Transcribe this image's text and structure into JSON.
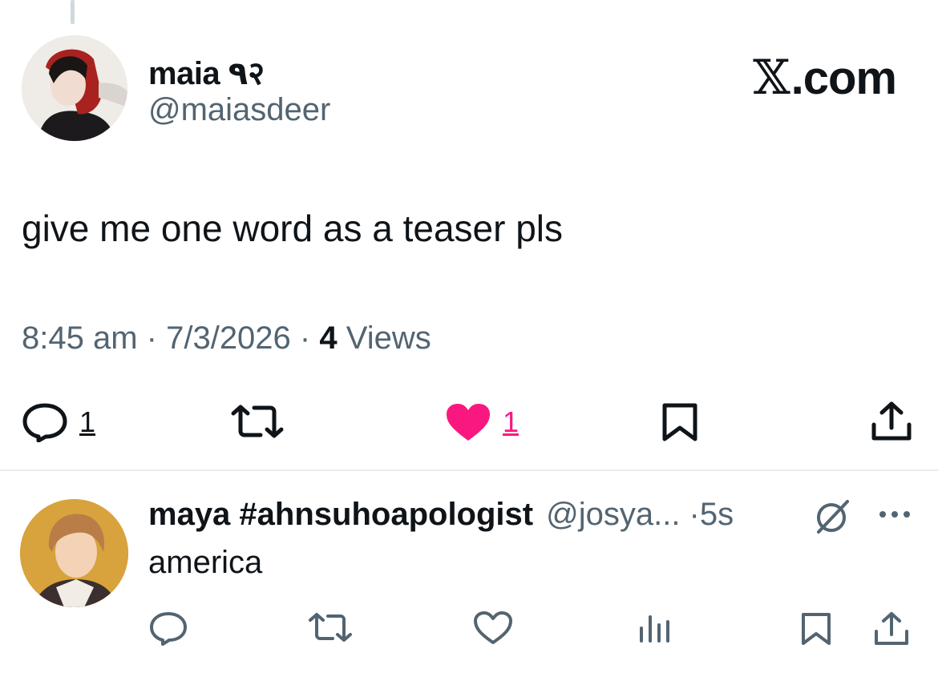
{
  "tweet": {
    "author_name": "maia ٩२",
    "author_handle": "@maiasdeer",
    "brand": ".com",
    "text": "give me one word as a teaser pls",
    "time": "8:45 am",
    "date": "7/3/2026",
    "views_count": "4",
    "views_label": "Views",
    "reply_count": "1",
    "like_count": "1"
  },
  "reply": {
    "author_name": "maya #ahnsuhoapologist",
    "author_handle": "@josya...",
    "time": "5s",
    "text": "america"
  },
  "colors": {
    "like_pink": "#f91880",
    "secondary_text": "#536471",
    "primary_text": "#0f1419",
    "divider": "#e6ebee"
  },
  "icons": [
    "reply-icon",
    "retweet-icon",
    "heart-filled-icon",
    "bookmark-icon",
    "share-icon",
    "grok-icon",
    "more-icon",
    "heart-outline-icon",
    "analytics-icon"
  ]
}
